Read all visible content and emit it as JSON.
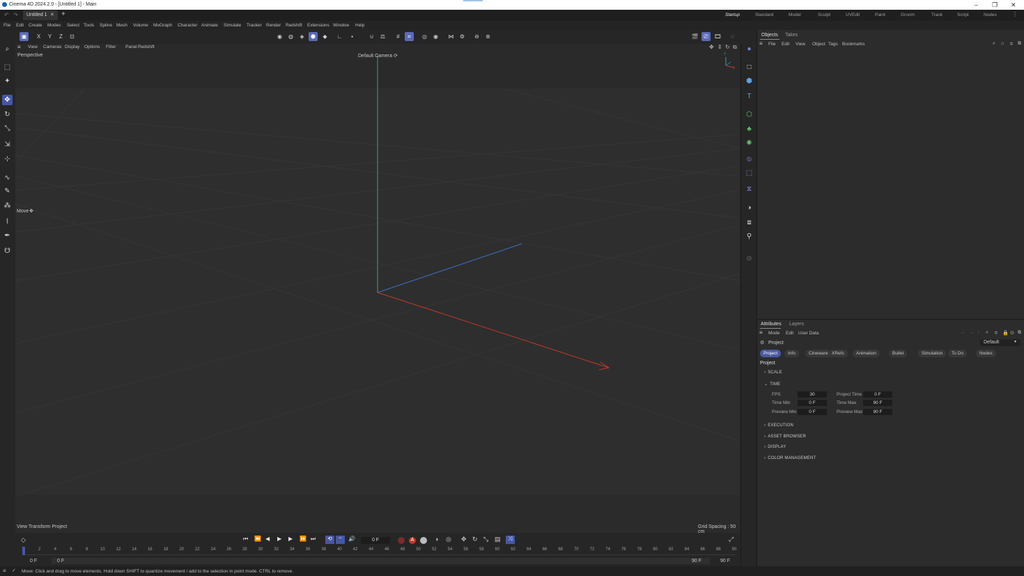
{
  "window": {
    "title": "Cinema 4D 2024.2.0 - [Untitled 1] - Main"
  },
  "tabs": {
    "doc_tab": "Untitled 1",
    "new_tab": "+"
  },
  "layouts": [
    "Startup",
    "Standard",
    "Model",
    "Sculpt",
    "UVEdit",
    "Paint",
    "Groom",
    "Track",
    "Script",
    "Nodes"
  ],
  "menu": [
    "File",
    "Edit",
    "Create",
    "Modes",
    "Select",
    "Tools",
    "Spline",
    "Mesh",
    "Volume",
    "MoGraph",
    "Character",
    "Animate",
    "Simulate",
    "Tracker",
    "Render",
    "Redshift",
    "Extensions",
    "Window",
    "Help"
  ],
  "axis_buttons": [
    "X",
    "Y",
    "Z"
  ],
  "viewport": {
    "menu": [
      "View",
      "Cameras",
      "Display",
      "Options",
      "Filter",
      "Panel",
      "Redshift"
    ],
    "name": "Perspective",
    "camera": "Default Camera",
    "tool_hint": "Move",
    "bottom_left": "View Transform Project",
    "grid_spacing": "Grid Spacing : 50 cm",
    "gizmo_y": "Y",
    "gizmo_x": "X"
  },
  "objects_panel": {
    "tabs": [
      "Objects",
      "Takes"
    ],
    "menu": [
      "File",
      "Edit",
      "View",
      "Object",
      "Tags",
      "Bookmarks"
    ]
  },
  "attributes_panel": {
    "tabs": [
      "Attributes",
      "Layers"
    ],
    "menu": [
      "Mode",
      "Edit",
      "User Data"
    ],
    "object_name": "Project",
    "preset": "Default",
    "subtabs": [
      "Project",
      "Info",
      "Cineware",
      "XRefs",
      "Animation",
      "Bullet",
      "Simulation",
      "To Do",
      "Nodes"
    ],
    "heading": "Project",
    "sections_top": [
      "SCALE",
      "TIME"
    ],
    "time_fields": {
      "fps_label": "FPS",
      "fps": "30",
      "project_time_label": "Project Time",
      "project_time": "0 F",
      "time_min_label": "Time Min",
      "time_min": "0 F",
      "time_max_label": "Time Max",
      "time_max": "90 F",
      "preview_min_label": "Preview Min",
      "preview_min": "0 F",
      "preview_max_label": "Preview Max",
      "preview_max": "90 F"
    },
    "sections_bottom": [
      "EXECUTION",
      "ASSET BROWSER",
      "DISPLAY",
      "COLOR MANAGEMENT"
    ]
  },
  "timeline": {
    "current_frame": "0 F",
    "ticks": [
      "0",
      "2",
      "4",
      "6",
      "8",
      "10",
      "12",
      "14",
      "16",
      "18",
      "20",
      "22",
      "24",
      "26",
      "28",
      "30",
      "32",
      "34",
      "36",
      "38",
      "40",
      "42",
      "44",
      "46",
      "48",
      "50",
      "52",
      "54",
      "56",
      "58",
      "60",
      "62",
      "64",
      "66",
      "68",
      "70",
      "72",
      "74",
      "76",
      "78",
      "80",
      "82",
      "84",
      "86",
      "88",
      "90"
    ],
    "range_start_a": "0 F",
    "range_start_b": "0 F",
    "range_end_a": "90 F",
    "range_end_b": "90 F"
  },
  "status": {
    "text": "Move: Click and drag to move elements. Hold down SHIFT to quantize movement / add to the selection in point mode. CTRL to remove."
  },
  "colors": {
    "accent": "#4657a3",
    "x_axis": "#c0392b",
    "y_axis": "#3fa37a",
    "z_axis": "#3b6fc4"
  }
}
